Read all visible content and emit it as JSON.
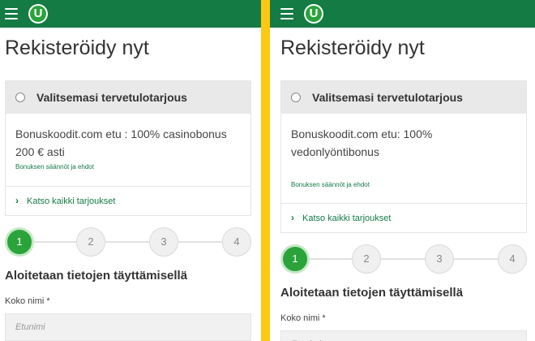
{
  "header": {
    "logo_text": "U"
  },
  "panels": [
    {
      "title": "Rekisteröidy nyt",
      "offer_radio_label": "Valitsemasi tervetulotarjous",
      "offer_description": "Bonuskoodit.com etu : 100% casinobonus 200 € asti",
      "terms_link": "Bonuksen säännöt ja ehdot",
      "view_all_offers": "Katso kaikki tarjoukset",
      "steps": [
        "1",
        "2",
        "3",
        "4"
      ],
      "active_step": 1,
      "section_heading": "Aloitetaan tietojen täyttämisellä",
      "full_name_label": "Koko nimi *",
      "first_name_placeholder": "Etunimi"
    },
    {
      "title": "Rekisteröidy nyt",
      "offer_radio_label": "Valitsemasi tervetulotarjous",
      "offer_description": "Bonuskoodit.com etu: 100% vedonlyöntibonus",
      "terms_link": "Bonuksen säännöt ja ehdot",
      "view_all_offers": "Katso kaikki tarjoukset",
      "steps": [
        "1",
        "2",
        "3",
        "4"
      ],
      "active_step": 1,
      "section_heading": "Aloitetaan tietojen täyttämisellä",
      "full_name_label": "Koko nimi *",
      "first_name_placeholder": "Etunimi"
    }
  ],
  "colors": {
    "brand_green": "#147b45",
    "active_step": "#2aa33b",
    "divider_yellow": "#fcc812"
  }
}
